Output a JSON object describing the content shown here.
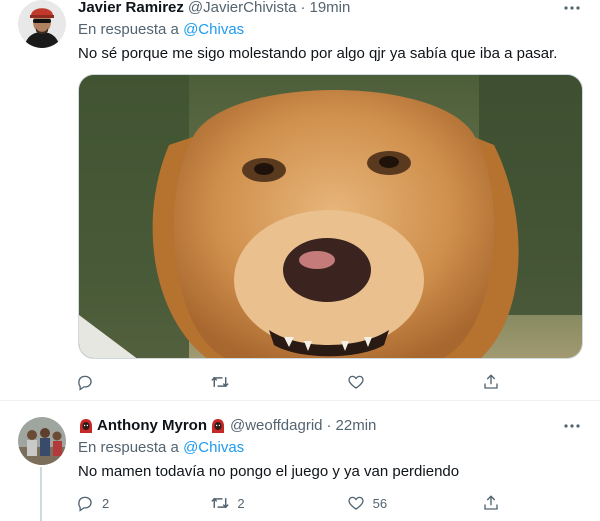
{
  "tweets": [
    {
      "name": "Javier Ramirez",
      "handle": "@JavierChivista",
      "separator": "·",
      "time": "19min",
      "reply_prefix": "En respuesta a",
      "reply_mention": "@Chivas",
      "text": "No sé porque me sigo molestando por algo qjr ya sabía que iba a pasar.",
      "has_media": true,
      "media_icon": "golden-retriever-photo",
      "actions": {
        "reply_count": "",
        "retweet_count": "",
        "like_count": ""
      }
    },
    {
      "name": "Anthony Myron",
      "handle": "@weoffdagrid",
      "separator": "·",
      "time": "22min",
      "name_emoji": "red-hooded-figure-emoji",
      "reply_prefix": "En respuesta a",
      "reply_mention": "@Chivas",
      "text": "No mamen todavía no pongo el juego y ya van perdiendo",
      "actions": {
        "reply_count": "2",
        "retweet_count": "2",
        "like_count": "56"
      }
    }
  ],
  "icons": {
    "reply": "reply-bubble-icon",
    "retweet": "retweet-icon",
    "like": "heart-icon",
    "share": "share-icon",
    "more": "more-dots-icon"
  },
  "colors": {
    "text": "#0f1419",
    "secondary": "#536471",
    "link": "#1d9bf0",
    "divider": "#eff3f4"
  }
}
